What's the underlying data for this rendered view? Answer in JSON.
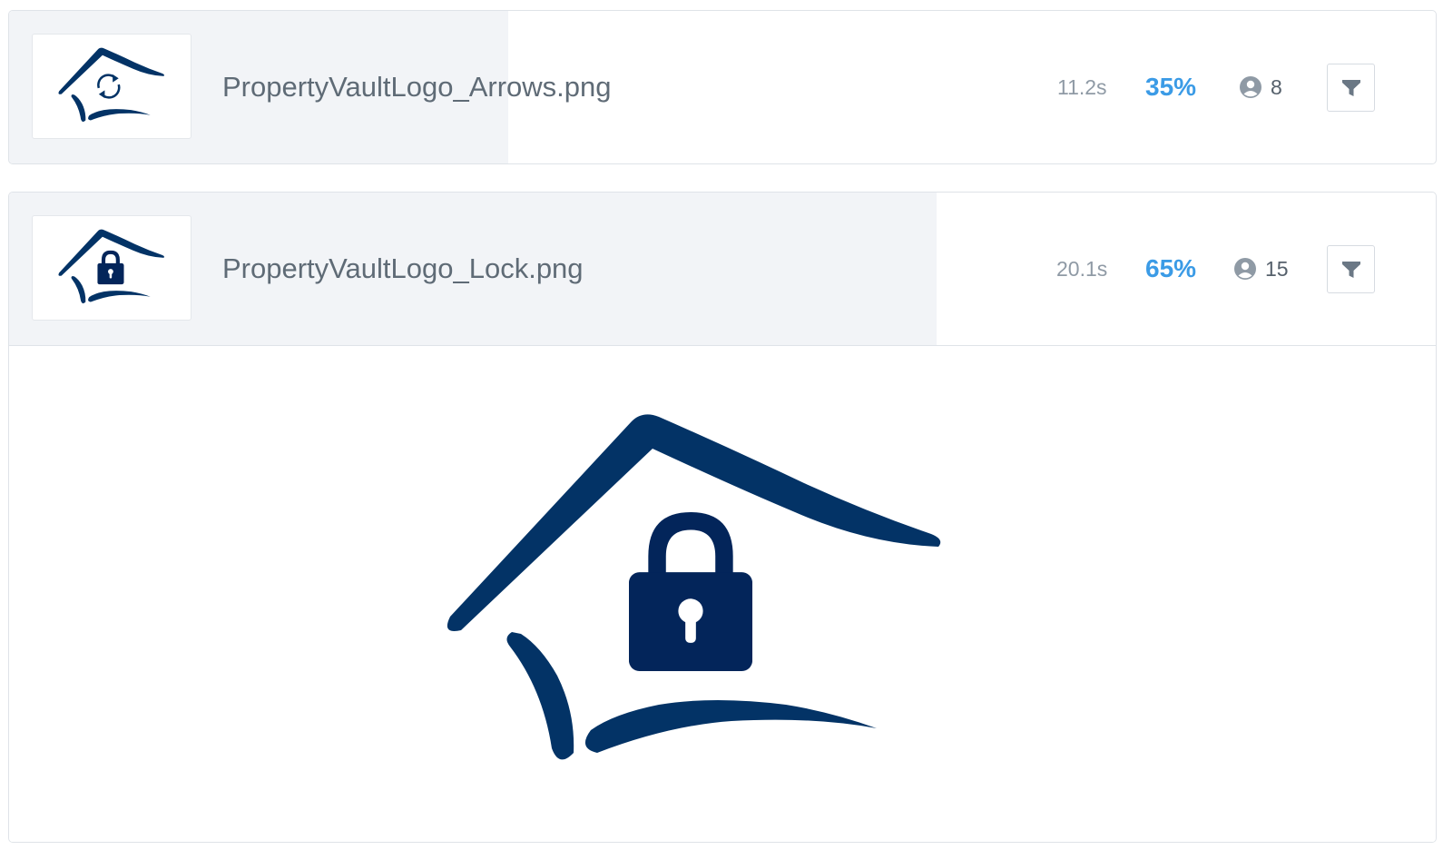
{
  "items": [
    {
      "filename": "PropertyVaultLogo_Arrows.png",
      "duration": "11.2s",
      "percent": "35%",
      "progress": 0.35,
      "viewers": "8",
      "thumbnail_icon": "house-arrows-logo-icon",
      "expanded": false
    },
    {
      "filename": "PropertyVaultLogo_Lock.png",
      "duration": "20.1s",
      "percent": "65%",
      "progress": 0.65,
      "viewers": "15",
      "thumbnail_icon": "house-lock-logo-icon",
      "expanded": true
    }
  ],
  "colors": {
    "brand_navy": "#033366",
    "accent_blue": "#3b9be6",
    "progress_fill": "#f2f4f7",
    "muted_text": "#8f9aa5"
  },
  "icons": {
    "viewers": "user-circle-icon",
    "filter": "filter-funnel-icon"
  }
}
